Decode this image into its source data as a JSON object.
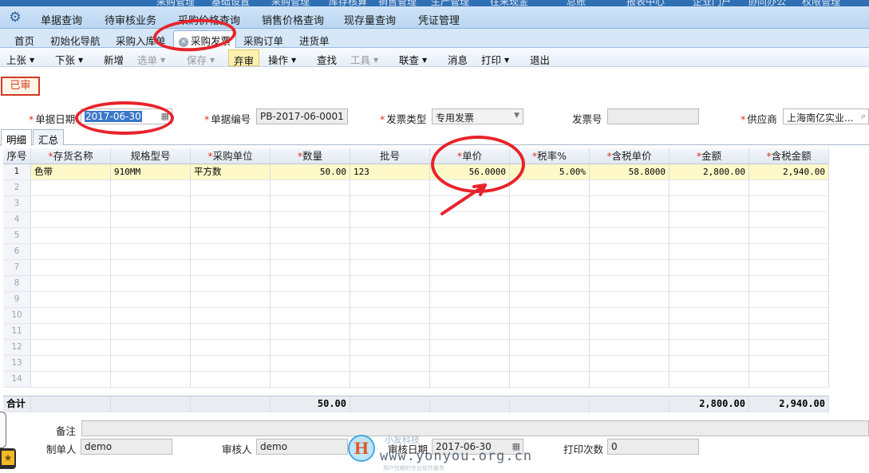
{
  "top_strip": [
    "采购管理",
    "基础设置",
    "采购管理",
    "库存核算",
    "销售管理",
    "生产管理",
    "往来现金",
    "总账",
    "报表中心",
    "企业门户",
    "协同办公",
    "权限管理"
  ],
  "menu": {
    "items": [
      "单据查询",
      "待审核业务",
      "采购价格查询",
      "销售价格查询",
      "现存量查询",
      "凭证管理"
    ]
  },
  "tabs": [
    "首页",
    "初始化导航",
    "采购入库单",
    "采购发票",
    "采购订单",
    "进货单"
  ],
  "active_tab_index": 3,
  "toolbar": [
    {
      "label": "上张",
      "caret": "▼",
      "disabled": false
    },
    {
      "label": "下张",
      "caret": "▼",
      "disabled": false
    },
    {
      "label": "新增",
      "caret": "",
      "disabled": false
    },
    {
      "label": "选单",
      "caret": "▼",
      "disabled": true
    },
    {
      "label": "保存",
      "caret": "▼",
      "disabled": true
    },
    {
      "label": "弃审",
      "caret": "",
      "disabled": false,
      "highlighted": true
    },
    {
      "label": "操作",
      "caret": "▼",
      "disabled": false
    },
    {
      "label": "查找",
      "caret": "",
      "disabled": false
    },
    {
      "label": "工具",
      "caret": "▼",
      "disabled": true
    },
    {
      "label": "联查",
      "caret": "▼",
      "disabled": false
    },
    {
      "label": "消息",
      "caret": "",
      "disabled": false
    },
    {
      "label": "打印",
      "caret": "▼",
      "disabled": false
    },
    {
      "label": "退出",
      "caret": "",
      "disabled": false
    }
  ],
  "status_badge": "已审",
  "header_fields": {
    "doc_date": {
      "label": "单据日期",
      "value": "2017-06-30",
      "required": "*"
    },
    "doc_no": {
      "label": "单据编号",
      "value": "PB-2017-06-0001",
      "required": "*"
    },
    "invoice_type": {
      "label": "发票类型",
      "value": "专用发票",
      "required": "*"
    },
    "invoice_no": {
      "label": "发票号",
      "value": ""
    },
    "supplier": {
      "label": "供应商",
      "value": "上海南亿实业...",
      "required": "*"
    }
  },
  "subtabs": [
    "明细",
    "汇总"
  ],
  "table": {
    "columns": [
      "序号",
      "存货名称",
      "规格型号",
      "采购单位",
      "数量",
      "批号",
      "单价",
      "税率%",
      "含税单价",
      "金额",
      "含税金额"
    ],
    "required_columns": [
      false,
      true,
      false,
      true,
      true,
      false,
      true,
      true,
      true,
      true,
      true
    ],
    "rows": [
      [
        "1",
        "色带",
        "910MM",
        "平方数",
        "50.00",
        "123",
        "56.0000",
        "5.00%",
        "58.8000",
        "2,800.00",
        "2,940.00"
      ]
    ],
    "empty_row_numbers": [
      "2",
      "3",
      "4",
      "5",
      "6",
      "7",
      "8",
      "9",
      "10",
      "11",
      "12",
      "13",
      "14"
    ],
    "totals": {
      "label": "合计",
      "quantity": "50.00",
      "amount": "2,800.00",
      "tax_amount": "2,940.00"
    }
  },
  "footer": {
    "remark_label": "备注",
    "remark_value": "",
    "creator_label": "制单人",
    "creator_value": "demo",
    "auditor_label": "审核人",
    "auditor_value": "demo",
    "audit_date_label": "审核日期",
    "audit_date_value": "2017-06-30",
    "print_count_label": "打印次数",
    "print_count_value": "0"
  },
  "watermark": {
    "cap": "小友科技",
    "text": "www.yonyou.org.cn",
    "sub": "用户信赖的专业软件服务"
  },
  "colors": {
    "accent": "#2f6fb3",
    "annotation_ring": "#e8232b",
    "selected_row": "#fff8c8",
    "required_mark": "#e0301e"
  },
  "icons": {
    "settings": "gear-icon",
    "tab_close": "close-icon",
    "calendar": "calendar-icon",
    "search": "search-icon",
    "favorites": "star-icon"
  }
}
